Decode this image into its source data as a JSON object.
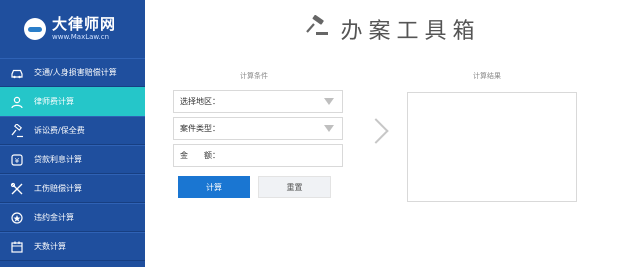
{
  "logo": {
    "title": "大律师网",
    "url": "www.MaxLaw.cn"
  },
  "sidebar": {
    "items": [
      {
        "label": "交通/人身损害赔偿计算",
        "icon": "car-icon"
      },
      {
        "label": "律师费计算",
        "icon": "user-icon",
        "active": true
      },
      {
        "label": "诉讼费/保全费",
        "icon": "gavel-icon"
      },
      {
        "label": "贷款利息计算",
        "icon": "bank-icon"
      },
      {
        "label": "工伤赔偿计算",
        "icon": "tools-icon"
      },
      {
        "label": "违约金计算",
        "icon": "badge-icon"
      },
      {
        "label": "天数计算",
        "icon": "calendar-icon"
      }
    ]
  },
  "header": {
    "title": "办案工具箱",
    "icon": "gavel-icon"
  },
  "form": {
    "conditions_label": "计算条件",
    "region_label": "选择地区：",
    "case_type_label": "案件类型：",
    "amount_label": "金　　额：",
    "calculate_button": "计算",
    "reset_button": "重置"
  },
  "result": {
    "label": "计算结果"
  },
  "colors": {
    "sidebar": "#1f4f9e",
    "active": "#25c6c9",
    "primary": "#1a76d2"
  }
}
